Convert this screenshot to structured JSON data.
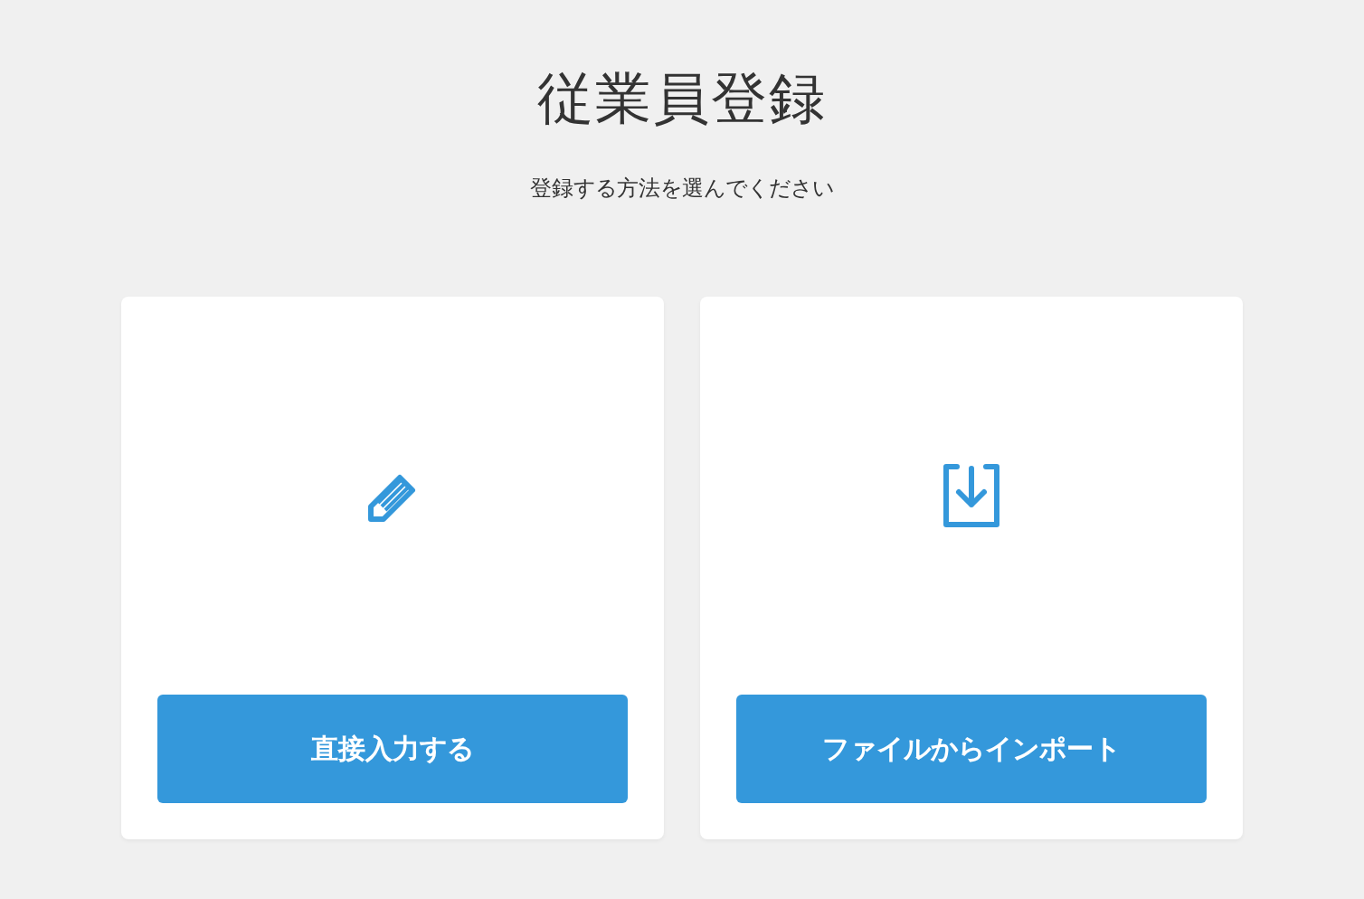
{
  "title": "従業員登録",
  "subtitle": "登録する方法を選んでください",
  "options": [
    {
      "kind": "manual",
      "button": "直接入力する"
    },
    {
      "kind": "import",
      "button": "ファイルからインポート"
    }
  ]
}
